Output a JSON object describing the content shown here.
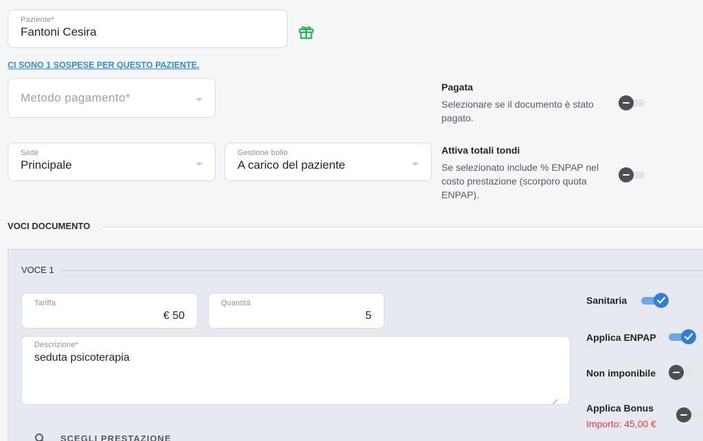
{
  "patient": {
    "label": "Paziente*",
    "value": "Fantoni Cesira"
  },
  "pending_link": "CI SONO 1 SOSPESE PER QUESTO PAZIENTE.",
  "payment": {
    "placeholder": "Metodo pagamento*"
  },
  "sede": {
    "label": "Sede",
    "value": "Principale"
  },
  "bollo": {
    "label": "Gestione bollo",
    "value": "A carico del paziente"
  },
  "pagata": {
    "title": "Pagata",
    "desc_lines": [
      "Selezionare se il documento è stato",
      "pagato."
    ],
    "enabled": false
  },
  "totali": {
    "title": "Attiva totali tondi",
    "desc_lines": [
      "Se selezionato include % ENPAP nel",
      "costo prestazione (scorporo quota",
      "ENPAP)."
    ],
    "enabled": false
  },
  "voci_section": "VOCI DOCUMENTO",
  "voce": {
    "title": "VOCE 1",
    "tariffa": {
      "label": "Tariffa",
      "value": "€ 50"
    },
    "quantita": {
      "label": "Quantità",
      "value": "5"
    },
    "descrizione": {
      "label": "Descrizione*",
      "value": "seduta psicoterapia"
    },
    "choose_service": "SCEGLI PRESTAZIONE",
    "flags": {
      "sanitaria": {
        "label": "Sanitaria",
        "enabled": true
      },
      "enpap": {
        "label": "Applica ENPAP",
        "enabled": true
      },
      "non_imponibile": {
        "label": "Non imponibile",
        "enabled": false
      },
      "bonus": {
        "label": "Applica Bonus",
        "importo": "Importo: 45,00 €",
        "enabled": false
      }
    }
  },
  "colors": {
    "accent": "#2f7fd9",
    "link": "#2f8de4",
    "gift_icon": "#22b24c",
    "importo": "#e53935"
  },
  "icons": {
    "gift": "gift-icon",
    "search": "search-icon"
  }
}
